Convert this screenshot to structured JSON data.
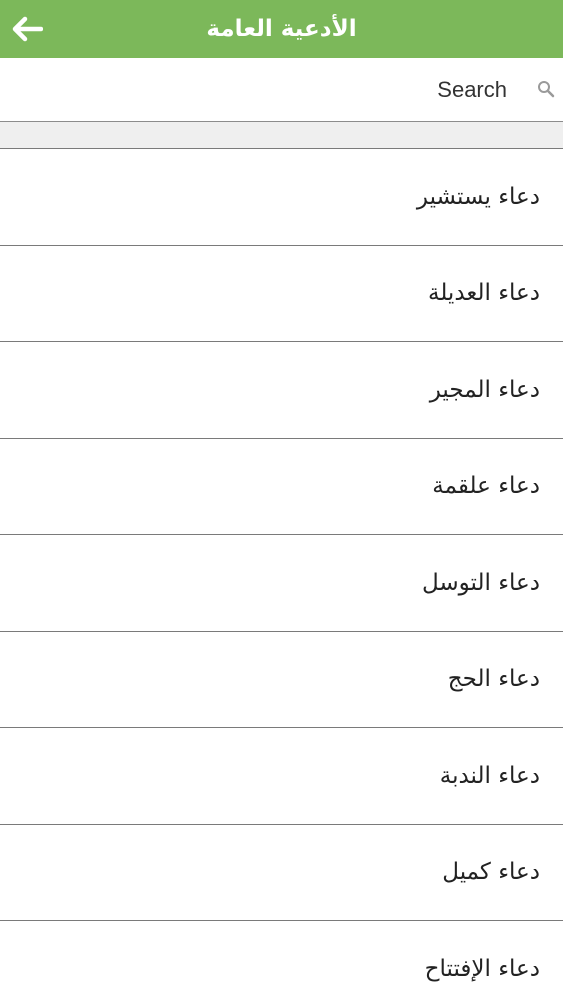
{
  "header": {
    "title": "الأدعية العامة",
    "back_icon": "arrow-left-icon",
    "background_color": "#7cb85a"
  },
  "search": {
    "placeholder": "Search",
    "icon": "search-icon"
  },
  "list": {
    "items": [
      {
        "label": "دعاء يستشير"
      },
      {
        "label": "دعاء العديلة"
      },
      {
        "label": "دعاء المجير"
      },
      {
        "label": "دعاء علقمة"
      },
      {
        "label": "دعاء التوسل"
      },
      {
        "label": "دعاء الحج"
      },
      {
        "label": "دعاء الندبة"
      },
      {
        "label": "دعاء كميل"
      },
      {
        "label": "دعاء الإفتتاح"
      }
    ]
  }
}
